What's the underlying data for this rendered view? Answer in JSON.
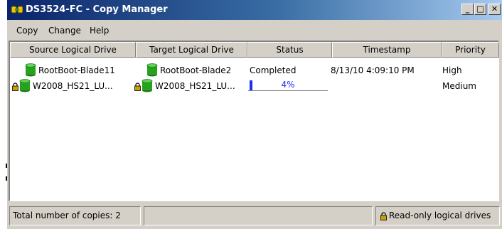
{
  "window": {
    "title": "DS3524-FC - Copy Manager"
  },
  "title_buttons": {
    "minimize": "_",
    "maximize": "□",
    "close": "✕"
  },
  "menu": [
    "Copy",
    "Change",
    "Help"
  ],
  "columns": [
    "Source Logical Drive",
    "Target Logical Drive",
    "Status",
    "Timestamp",
    "Priority"
  ],
  "rows": [
    {
      "source": "RootBoot-Blade11",
      "target": "RootBoot-Blade2",
      "status": "Completed",
      "timestamp": "8/13/10 4:09:10 PM",
      "priority": "High",
      "locked": false
    },
    {
      "source": "W2008_HS21_LU...",
      "target": "W2008_HS21_LU...",
      "status": "4%",
      "progress": 0.04,
      "timestamp": "",
      "priority": "Medium",
      "locked": true
    }
  ],
  "statusbar": {
    "total_copies": "Total number of copies: 2",
    "middle": "",
    "legend": "Read-only logical drives"
  },
  "colors": {
    "title_start": "#0a246a",
    "title_end": "#a6caf0",
    "drive_green": "#27a21f",
    "progress_blue": "#1c2ff0",
    "lock_gold": "#c9a000"
  },
  "icons": {
    "app": "copy-manager-icon",
    "drive": "logical-drive-icon",
    "lock": "lock-icon"
  }
}
